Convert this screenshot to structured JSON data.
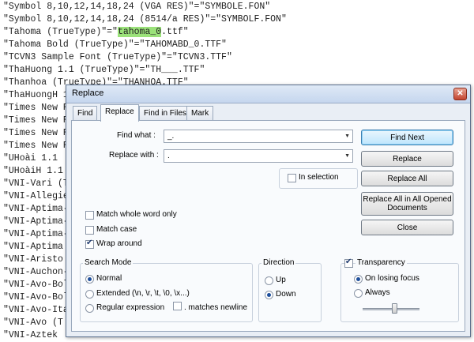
{
  "editor": {
    "lines": [
      {
        "pre": "\"Symbol 8,10,12,14,18,24 (VGA RES)\"=\"SYMBOLE.FON\"",
        "hl": "",
        "post": ""
      },
      {
        "pre": "\"Symbol 8,10,12,14,18,24 (8514/a RES)\"=\"SYMBOLF.FON\"",
        "hl": "",
        "post": ""
      },
      {
        "pre": "\"Tahoma (TrueType)\"=\"",
        "hl": "tahoma_0",
        "post": ".ttf\""
      },
      {
        "pre": "\"Tahoma Bold (TrueType)\"=\"TAHOMABD_0.TTF\"",
        "hl": "",
        "post": ""
      },
      {
        "pre": "\"TCVN3 Sample Font (TrueType)\"=\"TCVN3.TTF\"",
        "hl": "",
        "post": ""
      },
      {
        "pre": "\"ThaHuong 1.1 (TrueType)\"=\"TH___.TTF\"",
        "hl": "",
        "post": ""
      },
      {
        "pre": "\"Thanhoa (TrueType)\"=\"THANHOA.TTF\"",
        "hl": "",
        "post": ""
      },
      {
        "pre": "\"ThaHuongH 1",
        "hl": "",
        "post": ""
      },
      {
        "pre": "\"Times New R",
        "hl": "",
        "post": ""
      },
      {
        "pre": "\"Times New R",
        "hl": "",
        "post": ""
      },
      {
        "pre": "\"Times New R",
        "hl": "",
        "post": ""
      },
      {
        "pre": "\"Times New R",
        "hl": "",
        "post": ""
      },
      {
        "pre": "\"UHoài 1.1",
        "hl": "",
        "post": ""
      },
      {
        "pre": "\"UHoàiH 1.1",
        "hl": "",
        "post": ""
      },
      {
        "pre": "\"VNI-Vari (T",
        "hl": "",
        "post": ""
      },
      {
        "pre": "\"VNI-Allegie",
        "hl": "",
        "post": ""
      },
      {
        "pre": "\"VNI-Aptima-",
        "hl": "",
        "post": ""
      },
      {
        "pre": "\"VNI-Aptima-",
        "hl": "",
        "post": ""
      },
      {
        "pre": "\"VNI-Aptima-",
        "hl": "",
        "post": ""
      },
      {
        "pre": "\"VNI-Aptima",
        "hl": "",
        "post": ""
      },
      {
        "pre": "\"VNI-Aristo",
        "hl": "",
        "post": ""
      },
      {
        "pre": "\"VNI-Auchon-",
        "hl": "",
        "post": ""
      },
      {
        "pre": "\"VNI-Avo-Bol",
        "hl": "",
        "post": ""
      },
      {
        "pre": "\"VNI-Avo-Bol",
        "hl": "",
        "post": ""
      },
      {
        "pre": "\"VNI-Avo-Ita",
        "hl": "",
        "post": ""
      },
      {
        "pre": "\"VNI-Avo (T",
        "hl": "",
        "post": ""
      },
      {
        "pre": "\"VNI-Aztek",
        "hl": "",
        "post": ""
      }
    ]
  },
  "dialog": {
    "title": "Replace",
    "close_glyph": "✕",
    "tabs": [
      "Find",
      "Replace",
      "Find in Files",
      "Mark"
    ],
    "active_tab": "Replace",
    "find_what": {
      "label": "Find what :",
      "value": "_."
    },
    "replace_with": {
      "label": "Replace with :",
      "value": "."
    },
    "in_selection": {
      "label": "In selection",
      "checked": false
    },
    "buttons": {
      "find_next": "Find Next",
      "replace": "Replace",
      "replace_all": "Replace All",
      "replace_all_opened": "Replace All in All Opened Documents",
      "close": "Close"
    },
    "options": {
      "match_whole_word": {
        "label": "Match whole word only",
        "checked": false
      },
      "match_case": {
        "label": "Match case",
        "checked": false
      },
      "wrap_around": {
        "label": "Wrap around",
        "checked": true
      }
    },
    "search_mode": {
      "title": "Search Mode",
      "normal": "Normal",
      "extended": "Extended (\\n, \\r, \\t, \\0, \\x...)",
      "regex": "Regular expression",
      "matches_newline": ". matches newline",
      "selected": "normal"
    },
    "direction": {
      "title": "Direction",
      "up": "Up",
      "down": "Down",
      "selected": "down"
    },
    "transparency": {
      "title": "Transparency",
      "checked": true,
      "on_losing_focus": "On losing focus",
      "always": "Always",
      "selected": "on_losing_focus",
      "level": 0.55
    }
  }
}
